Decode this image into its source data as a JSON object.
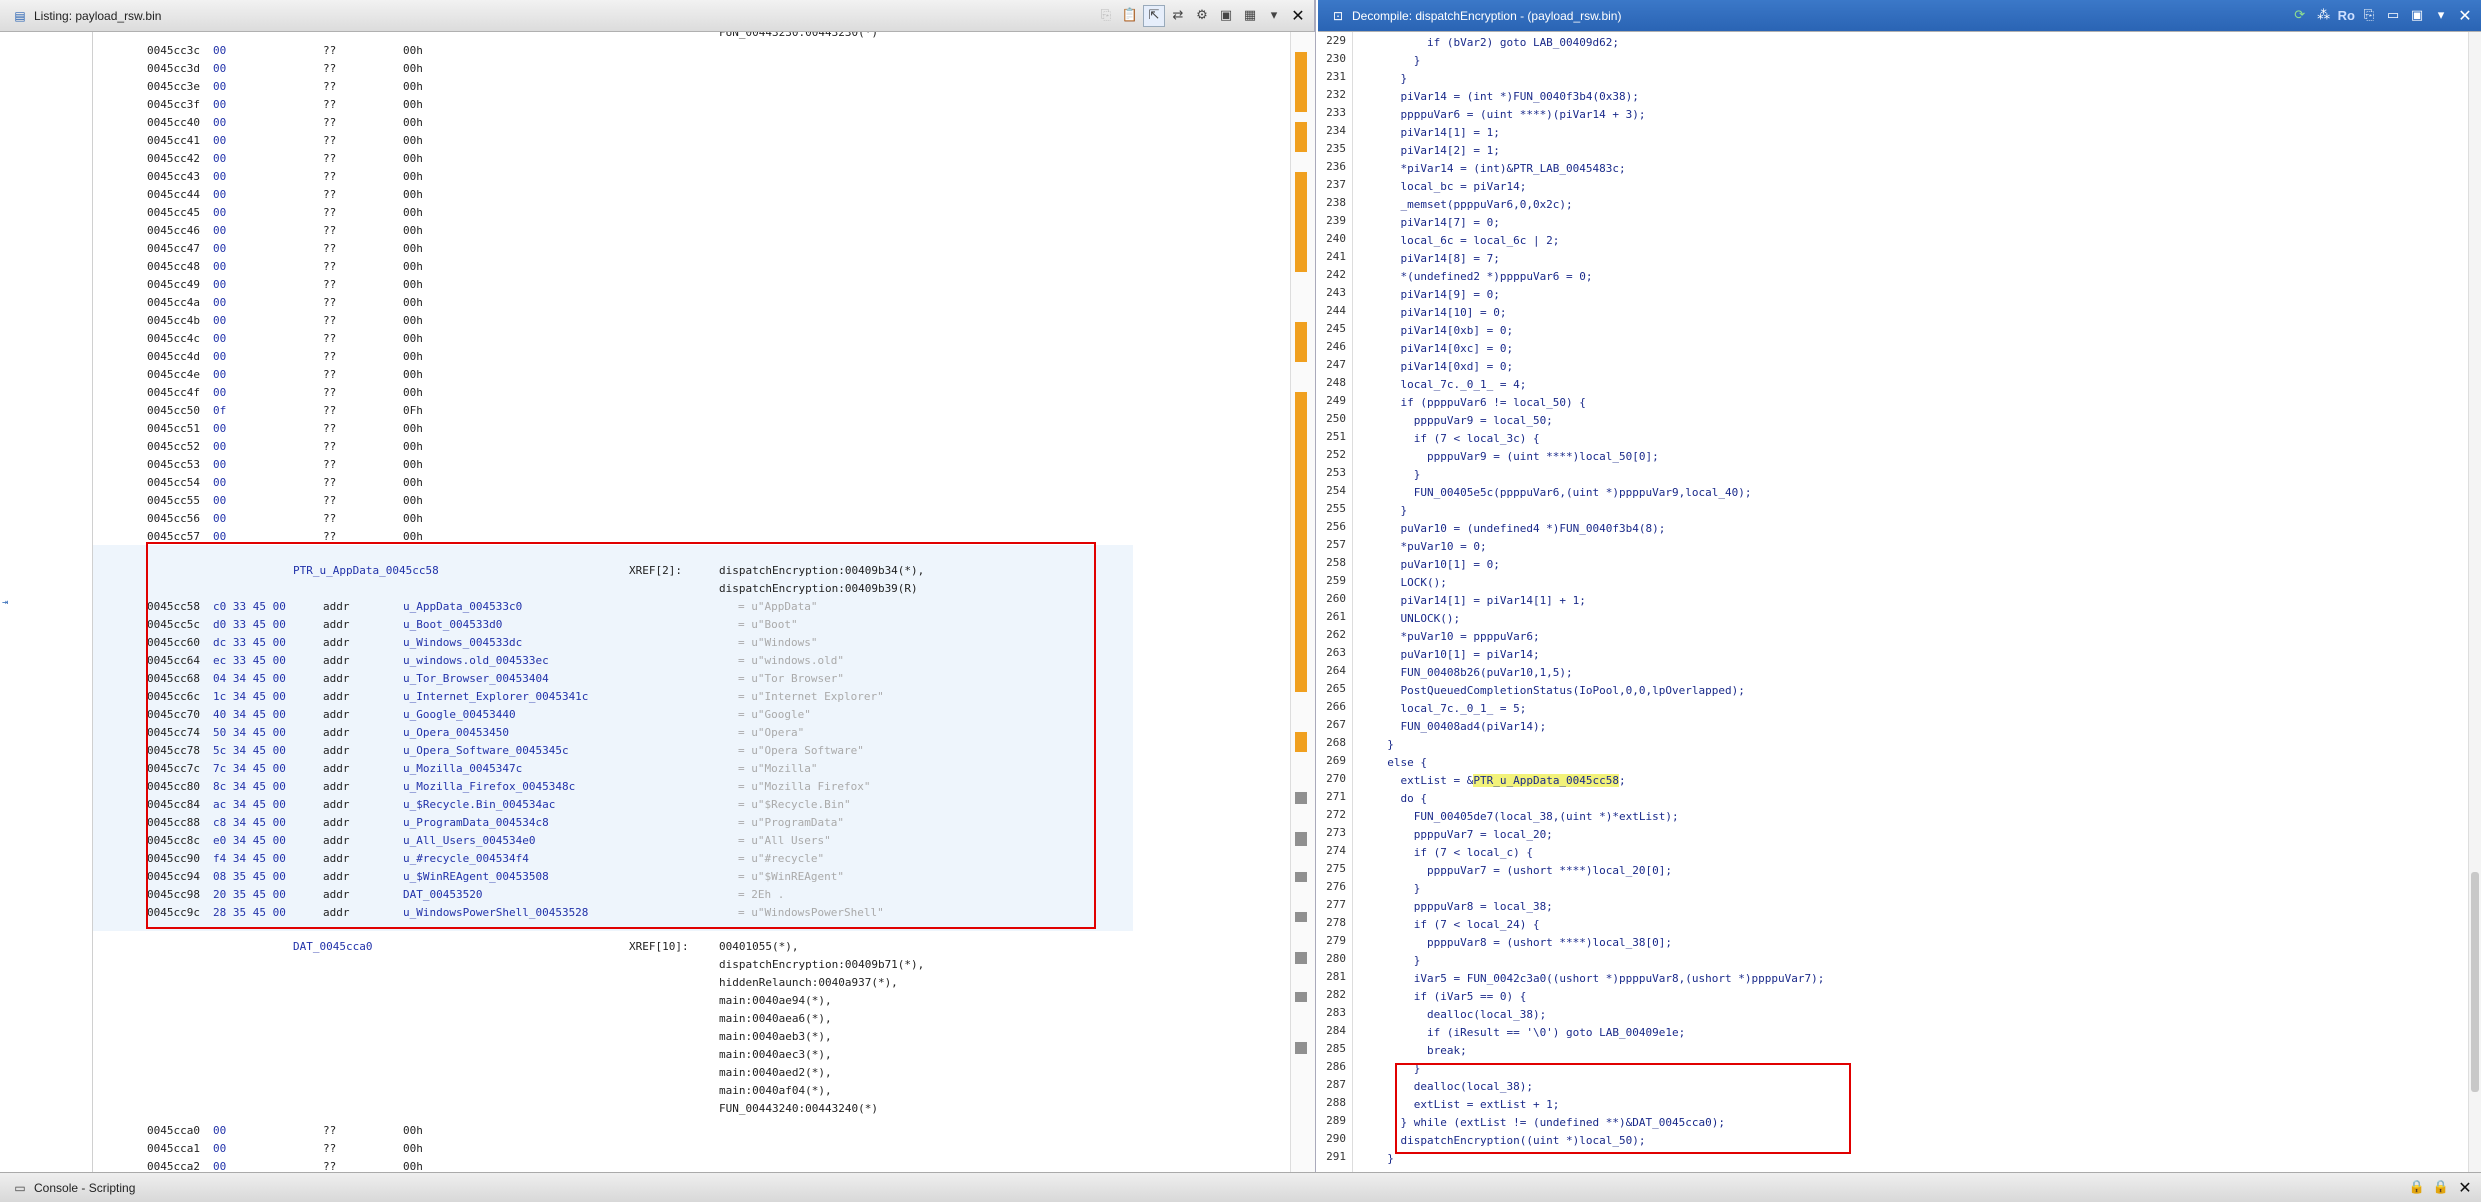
{
  "listing": {
    "title": "Listing:  payload_rsw.bin",
    "top_label": "FUN_00443230:00443230(*)",
    "rows_top": [
      {
        "addr": "0045cc3c",
        "byte": "00",
        "mn": "??",
        "val": "00h"
      },
      {
        "addr": "0045cc3d",
        "byte": "00",
        "mn": "??",
        "val": "00h"
      },
      {
        "addr": "0045cc3e",
        "byte": "00",
        "mn": "??",
        "val": "00h"
      },
      {
        "addr": "0045cc3f",
        "byte": "00",
        "mn": "??",
        "val": "00h"
      },
      {
        "addr": "0045cc40",
        "byte": "00",
        "mn": "??",
        "val": "00h"
      },
      {
        "addr": "0045cc41",
        "byte": "00",
        "mn": "??",
        "val": "00h"
      },
      {
        "addr": "0045cc42",
        "byte": "00",
        "mn": "??",
        "val": "00h"
      },
      {
        "addr": "0045cc43",
        "byte": "00",
        "mn": "??",
        "val": "00h"
      },
      {
        "addr": "0045cc44",
        "byte": "00",
        "mn": "??",
        "val": "00h"
      },
      {
        "addr": "0045cc45",
        "byte": "00",
        "mn": "??",
        "val": "00h"
      },
      {
        "addr": "0045cc46",
        "byte": "00",
        "mn": "??",
        "val": "00h"
      },
      {
        "addr": "0045cc47",
        "byte": "00",
        "mn": "??",
        "val": "00h"
      },
      {
        "addr": "0045cc48",
        "byte": "00",
        "mn": "??",
        "val": "00h"
      },
      {
        "addr": "0045cc49",
        "byte": "00",
        "mn": "??",
        "val": "00h"
      },
      {
        "addr": "0045cc4a",
        "byte": "00",
        "mn": "??",
        "val": "00h"
      },
      {
        "addr": "0045cc4b",
        "byte": "00",
        "mn": "??",
        "val": "00h"
      },
      {
        "addr": "0045cc4c",
        "byte": "00",
        "mn": "??",
        "val": "00h"
      },
      {
        "addr": "0045cc4d",
        "byte": "00",
        "mn": "??",
        "val": "00h"
      },
      {
        "addr": "0045cc4e",
        "byte": "00",
        "mn": "??",
        "val": "00h"
      },
      {
        "addr": "0045cc4f",
        "byte": "00",
        "mn": "??",
        "val": "00h"
      },
      {
        "addr": "0045cc50",
        "byte": "0f",
        "mn": "??",
        "val": "0Fh"
      },
      {
        "addr": "0045cc51",
        "byte": "00",
        "mn": "??",
        "val": "00h"
      },
      {
        "addr": "0045cc52",
        "byte": "00",
        "mn": "??",
        "val": "00h"
      },
      {
        "addr": "0045cc53",
        "byte": "00",
        "mn": "??",
        "val": "00h"
      },
      {
        "addr": "0045cc54",
        "byte": "00",
        "mn": "??",
        "val": "00h"
      },
      {
        "addr": "0045cc55",
        "byte": "00",
        "mn": "??",
        "val": "00h"
      },
      {
        "addr": "0045cc56",
        "byte": "00",
        "mn": "??",
        "val": "00h"
      },
      {
        "addr": "0045cc57",
        "byte": "00",
        "mn": "??",
        "val": "00h"
      }
    ],
    "ptr_label": "PTR_u_AppData_0045cc58",
    "ptr_xref_tag": "XREF[2]:",
    "ptr_xrefs": [
      "dispatchEncryption:00409b34(*),",
      "dispatchEncryption:00409b39(R)"
    ],
    "ptr_rows": [
      {
        "addr": "0045cc58",
        "bytes": "c0 33 45 00",
        "mn": "addr",
        "op": "u_AppData_004533c0",
        "str": "= u\"AppData\""
      },
      {
        "addr": "0045cc5c",
        "bytes": "d0 33 45 00",
        "mn": "addr",
        "op": "u_Boot_004533d0",
        "str": "= u\"Boot\""
      },
      {
        "addr": "0045cc60",
        "bytes": "dc 33 45 00",
        "mn": "addr",
        "op": "u_Windows_004533dc",
        "str": "= u\"Windows\""
      },
      {
        "addr": "0045cc64",
        "bytes": "ec 33 45 00",
        "mn": "addr",
        "op": "u_windows.old_004533ec",
        "str": "= u\"windows.old\""
      },
      {
        "addr": "0045cc68",
        "bytes": "04 34 45 00",
        "mn": "addr",
        "op": "u_Tor_Browser_00453404",
        "str": "= u\"Tor Browser\""
      },
      {
        "addr": "0045cc6c",
        "bytes": "1c 34 45 00",
        "mn": "addr",
        "op": "u_Internet_Explorer_0045341c",
        "str": "= u\"Internet Explorer\""
      },
      {
        "addr": "0045cc70",
        "bytes": "40 34 45 00",
        "mn": "addr",
        "op": "u_Google_00453440",
        "str": "= u\"Google\""
      },
      {
        "addr": "0045cc74",
        "bytes": "50 34 45 00",
        "mn": "addr",
        "op": "u_Opera_00453450",
        "str": "= u\"Opera\""
      },
      {
        "addr": "0045cc78",
        "bytes": "5c 34 45 00",
        "mn": "addr",
        "op": "u_Opera_Software_0045345c",
        "str": "= u\"Opera Software\""
      },
      {
        "addr": "0045cc7c",
        "bytes": "7c 34 45 00",
        "mn": "addr",
        "op": "u_Mozilla_0045347c",
        "str": "= u\"Mozilla\""
      },
      {
        "addr": "0045cc80",
        "bytes": "8c 34 45 00",
        "mn": "addr",
        "op": "u_Mozilla_Firefox_0045348c",
        "str": "= u\"Mozilla Firefox\""
      },
      {
        "addr": "0045cc84",
        "bytes": "ac 34 45 00",
        "mn": "addr",
        "op": "u_$Recycle.Bin_004534ac",
        "str": "= u\"$Recycle.Bin\""
      },
      {
        "addr": "0045cc88",
        "bytes": "c8 34 45 00",
        "mn": "addr",
        "op": "u_ProgramData_004534c8",
        "str": "= u\"ProgramData\""
      },
      {
        "addr": "0045cc8c",
        "bytes": "e0 34 45 00",
        "mn": "addr",
        "op": "u_All_Users_004534e0",
        "str": "= u\"All Users\""
      },
      {
        "addr": "0045cc90",
        "bytes": "f4 34 45 00",
        "mn": "addr",
        "op": "u_#recycle_004534f4",
        "str": "= u\"#recycle\""
      },
      {
        "addr": "0045cc94",
        "bytes": "08 35 45 00",
        "mn": "addr",
        "op": "u_$WinREAgent_00453508",
        "str": "= u\"$WinREAgent\""
      },
      {
        "addr": "0045cc98",
        "bytes": "20 35 45 00",
        "mn": "addr",
        "op": "DAT_00453520",
        "str": "= 2Eh    ."
      },
      {
        "addr": "0045cc9c",
        "bytes": "28 35 45 00",
        "mn": "addr",
        "op": "u_WindowsPowerShell_00453528",
        "str": "= u\"WindowsPowerShell\""
      }
    ],
    "dat_label": "DAT_0045cca0",
    "dat_xref_tag": "XREF[10]:",
    "dat_xrefs": [
      "00401055(*),",
      "dispatchEncryption:00409b71(*),",
      "hiddenRelaunch:0040a937(*),",
      "main:0040ae94(*),",
      "main:0040aea6(*),",
      "main:0040aeb3(*),",
      "main:0040aec3(*),",
      "main:0040aed2(*),",
      "main:0040af04(*),",
      "FUN_00443240:00443240(*)"
    ],
    "rows_bottom": [
      {
        "addr": "0045cca0",
        "byte": "00",
        "mn": "??",
        "val": "00h"
      },
      {
        "addr": "0045cca1",
        "byte": "00",
        "mn": "??",
        "val": "00h"
      },
      {
        "addr": "0045cca2",
        "byte": "00",
        "mn": "??",
        "val": "00h"
      }
    ]
  },
  "decompile": {
    "title": "Decompile: dispatchEncryption -  (payload_rsw.bin)",
    "ro_label": "Ro",
    "lines": [
      {
        "n": "229",
        "t": "        if (bVar2) goto LAB_00409d62;"
      },
      {
        "n": "230",
        "t": "      }"
      },
      {
        "n": "231",
        "t": "    }"
      },
      {
        "n": "232",
        "t": "    piVar14 = (int *)FUN_0040f3b4(0x38);"
      },
      {
        "n": "233",
        "t": "    ppppuVar6 = (uint ****)(piVar14 + 3);"
      },
      {
        "n": "234",
        "t": "    piVar14[1] = 1;"
      },
      {
        "n": "235",
        "t": "    piVar14[2] = 1;"
      },
      {
        "n": "236",
        "t": "    *piVar14 = (int)&PTR_LAB_0045483c;"
      },
      {
        "n": "237",
        "t": "    local_bc = piVar14;"
      },
      {
        "n": "238",
        "t": "    _memset(ppppuVar6,0,0x2c);"
      },
      {
        "n": "239",
        "t": "    piVar14[7] = 0;"
      },
      {
        "n": "240",
        "t": "    local_6c = local_6c | 2;"
      },
      {
        "n": "241",
        "t": "    piVar14[8] = 7;"
      },
      {
        "n": "242",
        "t": "    *(undefined2 *)ppppuVar6 = 0;"
      },
      {
        "n": "243",
        "t": "    piVar14[9] = 0;"
      },
      {
        "n": "244",
        "t": "    piVar14[10] = 0;"
      },
      {
        "n": "245",
        "t": "    piVar14[0xb] = 0;"
      },
      {
        "n": "246",
        "t": "    piVar14[0xc] = 0;"
      },
      {
        "n": "247",
        "t": "    piVar14[0xd] = 0;"
      },
      {
        "n": "248",
        "t": "    local_7c._0_1_ = 4;"
      },
      {
        "n": "249",
        "t": "    if (ppppuVar6 != local_50) {"
      },
      {
        "n": "250",
        "t": "      ppppuVar9 = local_50;"
      },
      {
        "n": "251",
        "t": "      if (7 < local_3c) {"
      },
      {
        "n": "252",
        "t": "        ppppuVar9 = (uint ****)local_50[0];"
      },
      {
        "n": "253",
        "t": "      }"
      },
      {
        "n": "254",
        "t": "      FUN_00405e5c(ppppuVar6,(uint *)ppppuVar9,local_40);"
      },
      {
        "n": "255",
        "t": "    }"
      },
      {
        "n": "256",
        "t": "    puVar10 = (undefined4 *)FUN_0040f3b4(8);"
      },
      {
        "n": "257",
        "t": "    *puVar10 = 0;"
      },
      {
        "n": "258",
        "t": "    puVar10[1] = 0;"
      },
      {
        "n": "259",
        "t": "    LOCK();"
      },
      {
        "n": "260",
        "t": "    piVar14[1] = piVar14[1] + 1;"
      },
      {
        "n": "261",
        "t": "    UNLOCK();"
      },
      {
        "n": "262",
        "t": "    *puVar10 = ppppuVar6;"
      },
      {
        "n": "263",
        "t": "    puVar10[1] = piVar14;"
      },
      {
        "n": "264",
        "t": "    FUN_00408b26(puVar10,1,5);"
      },
      {
        "n": "265",
        "t": "    PostQueuedCompletionStatus(IoPool,0,0,lpOverlapped);"
      },
      {
        "n": "266",
        "t": "    local_7c._0_1_ = 5;"
      },
      {
        "n": "267",
        "t": "    FUN_00408ad4(piVar14);"
      },
      {
        "n": "268",
        "t": "  }"
      },
      {
        "n": "269",
        "t": "  else {"
      },
      {
        "n": "270",
        "t": "    extList = &",
        "hl": "PTR_u_AppData_0045cc58",
        "after": ";"
      },
      {
        "n": "271",
        "t": "    do {"
      },
      {
        "n": "272",
        "t": "      FUN_00405de7(local_38,(uint *)*extList);"
      },
      {
        "n": "273",
        "t": "      ppppuVar7 = local_20;"
      },
      {
        "n": "274",
        "t": "      if (7 < local_c) {"
      },
      {
        "n": "275",
        "t": "        ppppuVar7 = (ushort ****)local_20[0];"
      },
      {
        "n": "276",
        "t": "      }"
      },
      {
        "n": "277",
        "t": "      ppppuVar8 = local_38;"
      },
      {
        "n": "278",
        "t": "      if (7 < local_24) {"
      },
      {
        "n": "279",
        "t": "        ppppuVar8 = (ushort ****)local_38[0];"
      },
      {
        "n": "280",
        "t": "      }"
      },
      {
        "n": "281",
        "t": "      iVar5 = FUN_0042c3a0((ushort *)ppppuVar8,(ushort *)ppppuVar7);"
      },
      {
        "n": "282",
        "t": "      if (iVar5 == 0) {"
      },
      {
        "n": "283",
        "t": "        dealloc(local_38);"
      },
      {
        "n": "284",
        "t": "        if (iResult == '\\0') goto LAB_00409e1e;"
      },
      {
        "n": "285",
        "t": "        break;"
      },
      {
        "n": "286",
        "t": "      }"
      },
      {
        "n": "287",
        "t": "      dealloc(local_38);"
      },
      {
        "n": "288",
        "t": "      extList = extList + 1;"
      },
      {
        "n": "289",
        "t": "    } while (extList != (undefined **)&DAT_0045cca0);"
      },
      {
        "n": "290",
        "t": "    dispatchEncryption((uint *)local_50);"
      },
      {
        "n": "291",
        "t": "  }"
      }
    ]
  },
  "console": {
    "title": "Console - Scripting"
  },
  "icons": {
    "listing_toolbar": [
      "copy-icon",
      "paste-icon",
      "cursor-icon",
      "navigate-icon",
      "snapshot-icon",
      "camera-icon",
      "layout-icon",
      "more-icon"
    ],
    "decomp_toolbar": [
      "refresh-icon",
      "graph-icon",
      "copy-icon",
      "paste-icon",
      "camera-icon",
      "more-icon"
    ]
  }
}
